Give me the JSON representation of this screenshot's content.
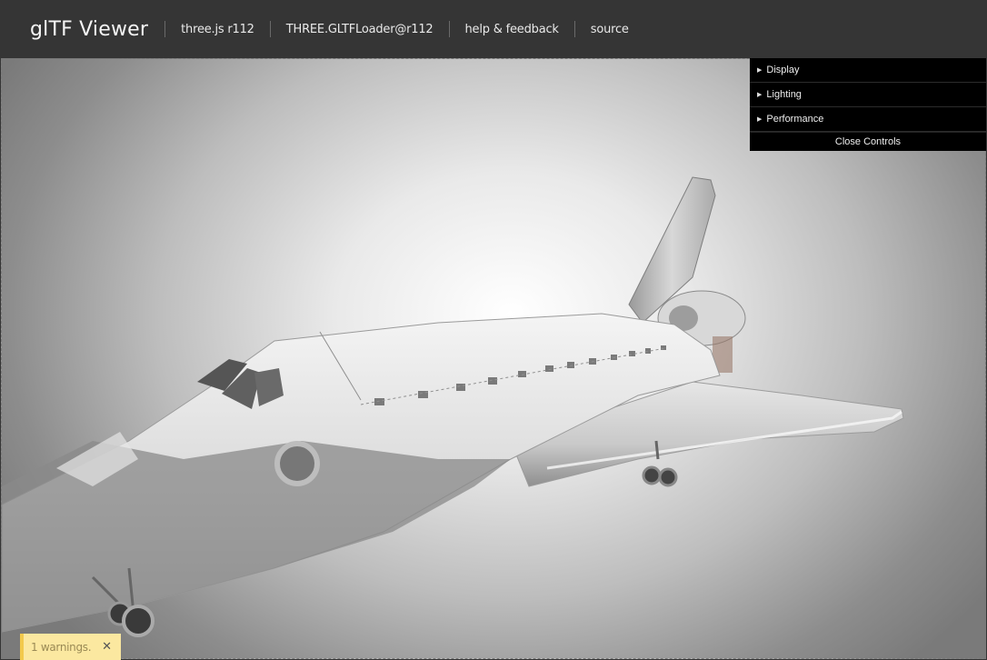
{
  "header": {
    "title": "glTF Viewer",
    "links": [
      "three.js r112",
      "THREE.GLTFLoader@r112",
      "help & feedback",
      "source"
    ]
  },
  "controls": {
    "folders": [
      "Display",
      "Lighting",
      "Performance"
    ],
    "close_label": "Close Controls"
  },
  "toast": {
    "message": "1 warnings.",
    "close_glyph": "✕"
  },
  "colors": {
    "header_bg": "#353535",
    "controls_bg": "#000000",
    "toast_bg": "#fbe8a0"
  }
}
